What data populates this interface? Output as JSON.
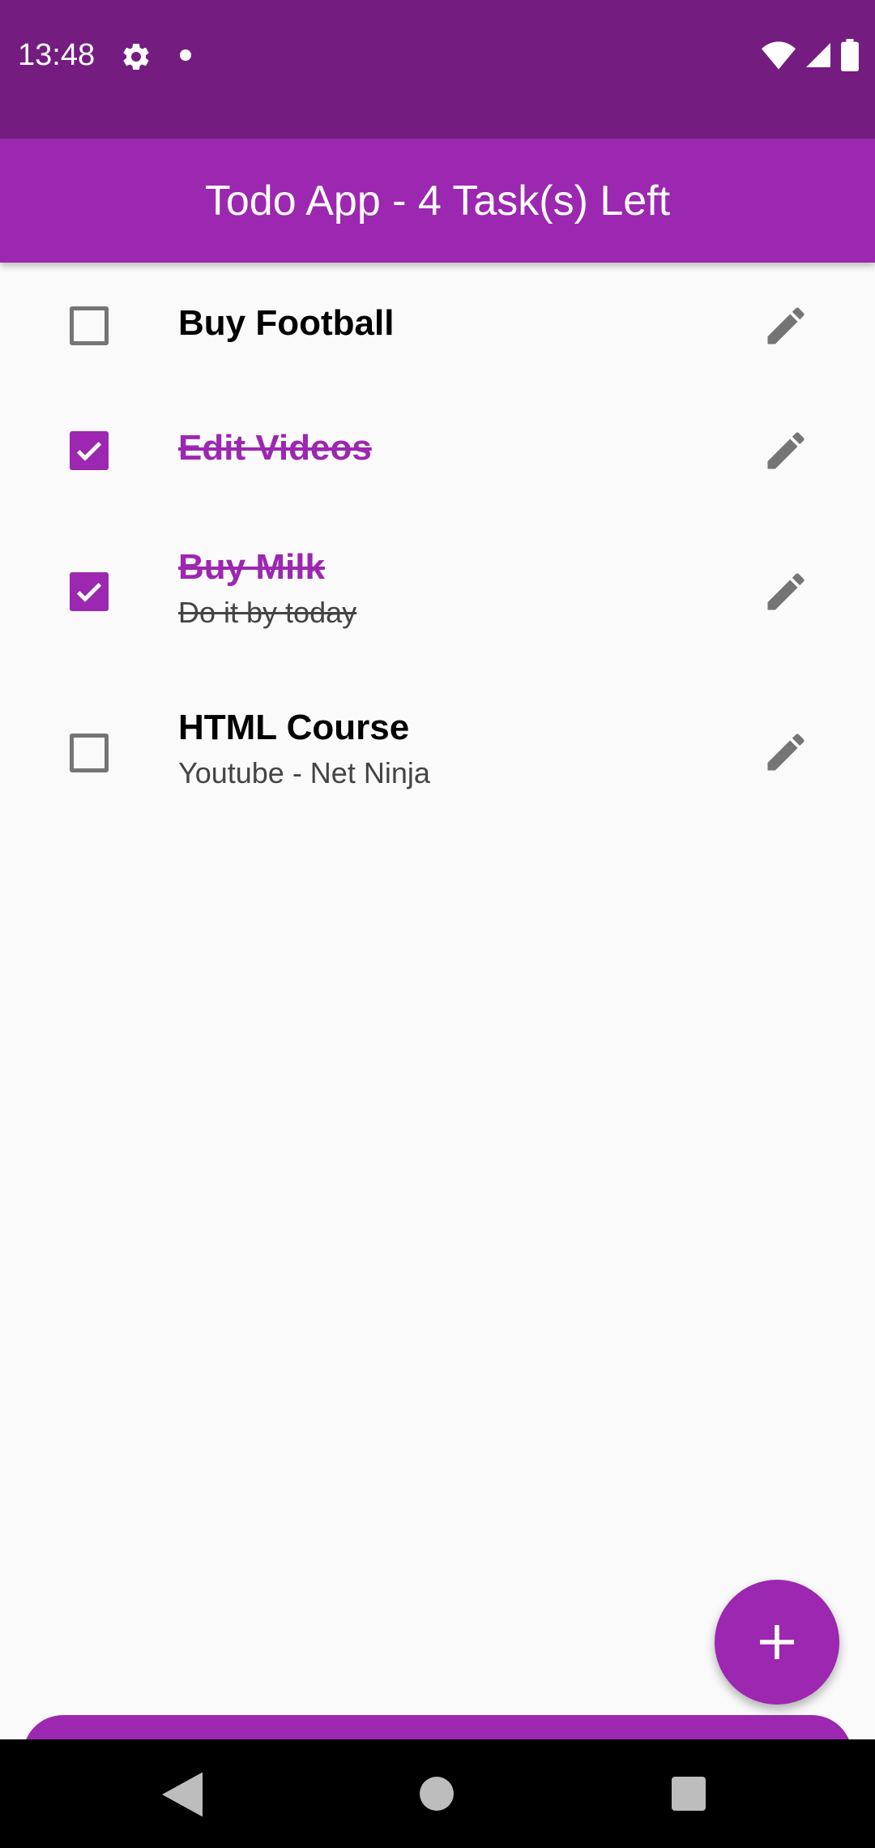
{
  "status_bar": {
    "time": "13:48",
    "icons": [
      "settings-gear-icon",
      "notification-dot-icon",
      "wifi-icon",
      "cell-signal-icon",
      "battery-icon"
    ]
  },
  "app_bar": {
    "title": "Todo App - 4 Task(s) Left"
  },
  "todos": [
    {
      "title": "Buy Football",
      "subtitle": "",
      "completed": false
    },
    {
      "title": "Edit Videos",
      "subtitle": "",
      "completed": true
    },
    {
      "title": "Buy Milk",
      "subtitle": "Do it by today",
      "completed": true
    },
    {
      "title": "HTML Course",
      "subtitle": "Youtube - Net Ninja",
      "completed": false
    }
  ],
  "fab": {
    "icon": "plus-icon"
  },
  "nav_bar": {
    "icons": [
      "back-icon",
      "home-icon",
      "recents-icon"
    ]
  },
  "colors": {
    "primary": "#9C27B0",
    "status_bar": "#741C80",
    "background": "#FAFAFA",
    "icon_gray": "#757575"
  }
}
